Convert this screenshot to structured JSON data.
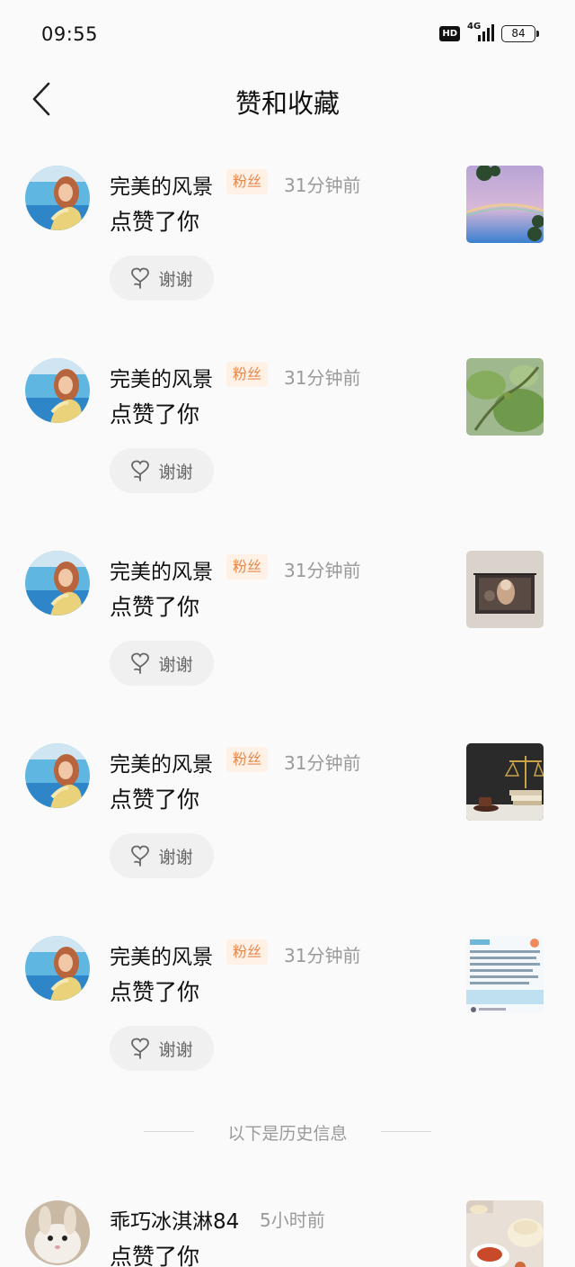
{
  "status_bar": {
    "time": "09:55",
    "hd_label": "HD",
    "network_label": "4G",
    "battery": "84"
  },
  "header": {
    "title": "赞和收藏",
    "back_icon": "chevron-left-icon"
  },
  "notifications": [
    {
      "nickname": "完美的风景",
      "badge": "粉丝",
      "time": "31分钟前",
      "action": "点赞了你",
      "thanks_label": "谢谢",
      "thumb": "sky-rainbow-photo"
    },
    {
      "nickname": "完美的风景",
      "badge": "粉丝",
      "time": "31分钟前",
      "action": "点赞了你",
      "thanks_label": "谢谢",
      "thumb": "fig-leaves-photo"
    },
    {
      "nickname": "完美的风景",
      "badge": "粉丝",
      "time": "31分钟前",
      "action": "点赞了你",
      "thanks_label": "谢谢",
      "thumb": "wall-painting-photo"
    },
    {
      "nickname": "完美的风景",
      "badge": "粉丝",
      "time": "31分钟前",
      "action": "点赞了你",
      "thanks_label": "谢谢",
      "thumb": "justice-scale-photo"
    },
    {
      "nickname": "完美的风景",
      "badge": "粉丝",
      "time": "31分钟前",
      "action": "点赞了你",
      "thanks_label": "谢谢",
      "thumb": "text-document-photo"
    }
  ],
  "history_divider": "以下是历史信息",
  "history": [
    {
      "nickname": "乖巧冰淇淋84",
      "time": "5小时前",
      "action": "点赞了你",
      "thumb": "dimsum-food-photo"
    }
  ],
  "colors": {
    "background": "#fafafa",
    "badge_bg": "#fff1e6",
    "badge_text": "#e8874a",
    "secondary_text": "#9a9a9a",
    "button_bg": "#f0f0f0"
  }
}
